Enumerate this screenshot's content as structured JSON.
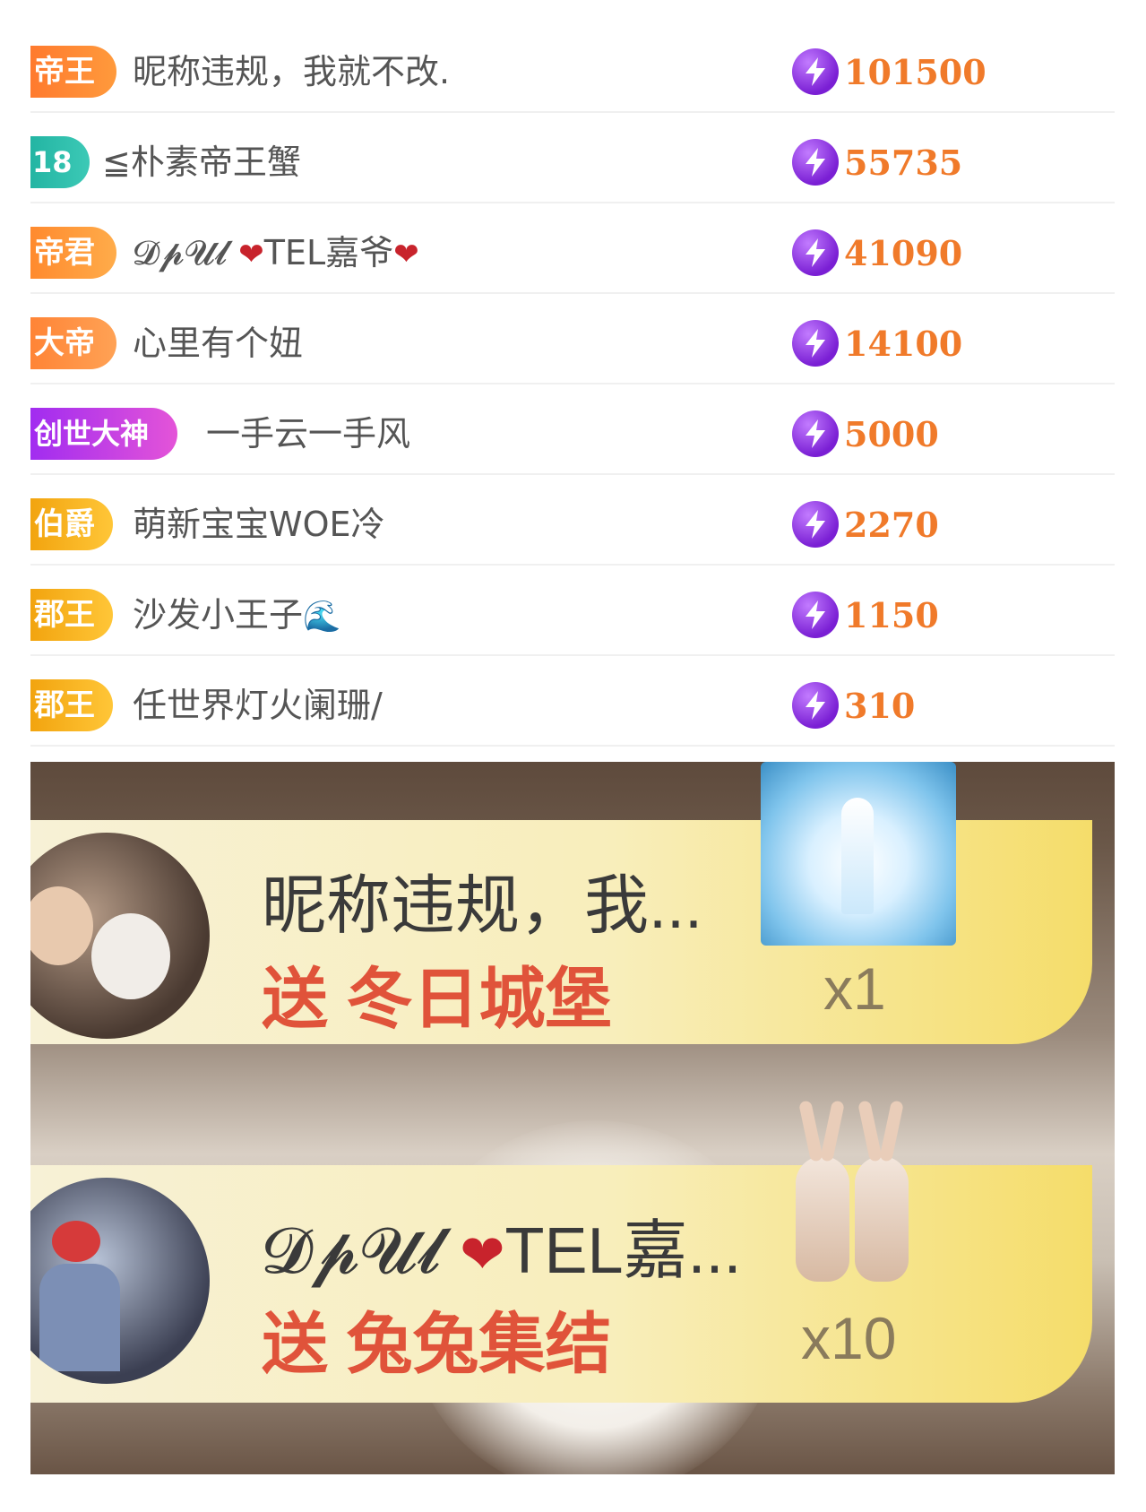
{
  "ranking": [
    {
      "badge": "帝王",
      "name": "昵称违规，我就不改.",
      "amount": "101500"
    },
    {
      "badge": "18",
      "name": "≦朴素帝王蟹",
      "amount": "55735"
    },
    {
      "badge": "帝君",
      "name_prefix": "𝓓𝓹𝓤𝓵",
      "name_mid": "TEL嘉爷",
      "amount": "41090"
    },
    {
      "badge": "大帝",
      "name": "心里有个妞",
      "amount": "14100"
    },
    {
      "badge": "创世大神",
      "name": "一手云一手风",
      "amount": "5000"
    },
    {
      "badge": "伯爵",
      "name": "萌新宝宝WOE冷",
      "amount": "2270"
    },
    {
      "badge": "郡王",
      "name": "沙发小王子",
      "amount": "1150"
    },
    {
      "badge": "郡王",
      "name": "任世界灯火阑珊/",
      "amount": "310"
    }
  ],
  "gifts": [
    {
      "sender": "昵称违规，我...",
      "action": "送",
      "gift_name": "冬日城堡",
      "count": "x1"
    },
    {
      "sender_prefix": "𝓓𝓹𝓤𝓵",
      "sender_suffix": "TEL嘉...",
      "action": "送",
      "gift_name": "兔兔集结",
      "count": "x10"
    }
  ],
  "colors": {
    "amount": "#f07a2a",
    "gift_name": "#e0533a",
    "currency_icon": "#7a1fd4"
  },
  "icons": {
    "currency": "lightning-bolt-icon",
    "heart": "heart-icon",
    "wave": "wave-icon"
  }
}
